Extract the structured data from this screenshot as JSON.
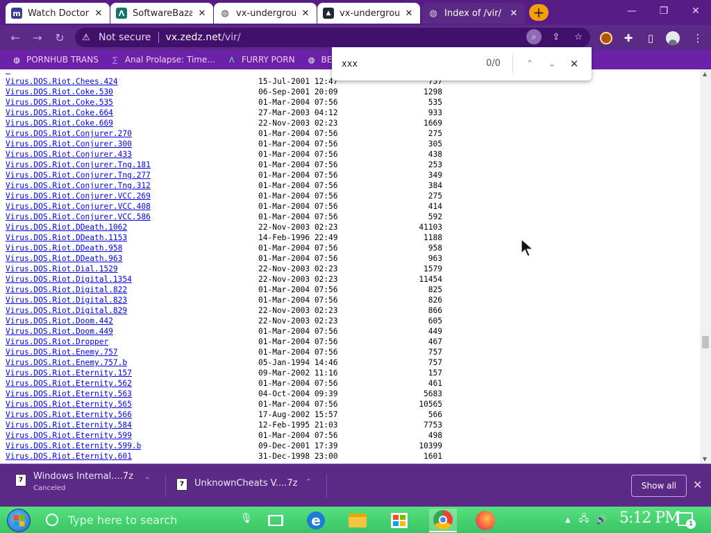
{
  "tabs": [
    {
      "label": "Watch Doctor",
      "icon": "m",
      "color": "#3b3b98",
      "state": "inactive"
    },
    {
      "label": "SoftwareBazaa",
      "icon": "Λ",
      "color": "#0f766e",
      "state": "inactive"
    },
    {
      "label": "vx-undergroun",
      "icon": "globe",
      "color": "#444444",
      "state": "inactive"
    },
    {
      "label": "vx-undergroun",
      "icon": "square",
      "color": "#1f2937",
      "state": "inactive"
    },
    {
      "label": "Index of /vir/",
      "icon": "globe",
      "color": "#6b7280",
      "state": "active"
    }
  ],
  "omnibox": {
    "security": "Not secure",
    "host": "vx.zedz.net",
    "path": "/vir/"
  },
  "bookmarks": [
    {
      "label": "PORNHUB TRANS",
      "icon": "globe"
    },
    {
      "label": "Anal Prolapse: Time...",
      "icon": "sigma"
    },
    {
      "label": "FURRY PORN",
      "icon": "Λ"
    },
    {
      "label": "BES",
      "icon": "globe"
    }
  ],
  "find": {
    "query": "xxx",
    "count": "0/0"
  },
  "files": [
    {
      "name": "Virus.DOS.Riot.Chees.424",
      "date": "15-Jul-2001 12:47",
      "size": "757"
    },
    {
      "name": "Virus.DOS.Riot.Coke.530",
      "date": "06-Sep-2001 20:09",
      "size": "1298"
    },
    {
      "name": "Virus.DOS.Riot.Coke.535",
      "date": "01-Mar-2004 07:56",
      "size": "535"
    },
    {
      "name": "Virus.DOS.Riot.Coke.664",
      "date": "27-Mar-2003 04:12",
      "size": "933"
    },
    {
      "name": "Virus.DOS.Riot.Coke.669",
      "date": "22-Nov-2003 02:23",
      "size": "1669"
    },
    {
      "name": "Virus.DOS.Riot.Conjurer.270",
      "date": "01-Mar-2004 07:56",
      "size": "275"
    },
    {
      "name": "Virus.DOS.Riot.Conjurer.300",
      "date": "01-Mar-2004 07:56",
      "size": "305"
    },
    {
      "name": "Virus.DOS.Riot.Conjurer.433",
      "date": "01-Mar-2004 07:56",
      "size": "438"
    },
    {
      "name": "Virus.DOS.Riot.Conjurer.Tng.181",
      "date": "01-Mar-2004 07:56",
      "size": "253"
    },
    {
      "name": "Virus.DOS.Riot.Conjurer.Tng.277",
      "date": "01-Mar-2004 07:56",
      "size": "349"
    },
    {
      "name": "Virus.DOS.Riot.Conjurer.Tng.312",
      "date": "01-Mar-2004 07:56",
      "size": "384"
    },
    {
      "name": "Virus.DOS.Riot.Conjurer.VCC.269",
      "date": "01-Mar-2004 07:56",
      "size": "275"
    },
    {
      "name": "Virus.DOS.Riot.Conjurer.VCC.408",
      "date": "01-Mar-2004 07:56",
      "size": "414"
    },
    {
      "name": "Virus.DOS.Riot.Conjurer.VCC.586",
      "date": "01-Mar-2004 07:56",
      "size": "592"
    },
    {
      "name": "Virus.DOS.Riot.DDeath.1062",
      "date": "22-Nov-2003 02:23",
      "size": "41103"
    },
    {
      "name": "Virus.DOS.Riot.DDeath.1153",
      "date": "14-Feb-1996 22:49",
      "size": "1188"
    },
    {
      "name": "Virus.DOS.Riot.DDeath.958",
      "date": "01-Mar-2004 07:56",
      "size": "958"
    },
    {
      "name": "Virus.DOS.Riot.DDeath.963",
      "date": "01-Mar-2004 07:56",
      "size": "963"
    },
    {
      "name": "Virus.DOS.Riot.Dial.1529",
      "date": "22-Nov-2003 02:23",
      "size": "1579"
    },
    {
      "name": "Virus.DOS.Riot.Digital.1354",
      "date": "22-Nov-2003 02:23",
      "size": "11454"
    },
    {
      "name": "Virus.DOS.Riot.Digital.822",
      "date": "01-Mar-2004 07:56",
      "size": "825"
    },
    {
      "name": "Virus.DOS.Riot.Digital.823",
      "date": "01-Mar-2004 07:56",
      "size": "826"
    },
    {
      "name": "Virus.DOS.Riot.Digital.829",
      "date": "22-Nov-2003 02:23",
      "size": "866"
    },
    {
      "name": "Virus.DOS.Riot.Doom.442",
      "date": "22-Nov-2003 02:23",
      "size": "605"
    },
    {
      "name": "Virus.DOS.Riot.Doom.449",
      "date": "01-Mar-2004 07:56",
      "size": "449"
    },
    {
      "name": "Virus.DOS.Riot.Dropper",
      "date": "01-Mar-2004 07:56",
      "size": "467"
    },
    {
      "name": "Virus.DOS.Riot.Enemy.757",
      "date": "01-Mar-2004 07:56",
      "size": "757"
    },
    {
      "name": "Virus.DOS.Riot.Enemy.757.b",
      "date": "05-Jan-1994 14:46",
      "size": "757"
    },
    {
      "name": "Virus.DOS.Riot.Eternity.157",
      "date": "09-Mar-2002 11:16",
      "size": "157"
    },
    {
      "name": "Virus.DOS.Riot.Eternity.562",
      "date": "01-Mar-2004 07:56",
      "size": "461"
    },
    {
      "name": "Virus.DOS.Riot.Eternity.563",
      "date": "04-Oct-2004 09:39",
      "size": "5683"
    },
    {
      "name": "Virus.DOS.Riot.Eternity.565",
      "date": "01-Mar-2004 07:56",
      "size": "10565"
    },
    {
      "name": "Virus.DOS.Riot.Eternity.566",
      "date": "17-Aug-2002 15:57",
      "size": "566"
    },
    {
      "name": "Virus.DOS.Riot.Eternity.584",
      "date": "12-Feb-1995 21:03",
      "size": "7753"
    },
    {
      "name": "Virus.DOS.Riot.Eternity.599",
      "date": "01-Mar-2004 07:56",
      "size": "498"
    },
    {
      "name": "Virus.DOS.Riot.Eternity.599.b",
      "date": "09-Dec-2001 17:39",
      "size": "10399"
    },
    {
      "name": "Virus.DOS.Riot.Eternity.601",
      "date": "31-Dec-1998 23:00",
      "size": "1601"
    }
  ],
  "downloads": [
    {
      "name": "Windows Internal....7z",
      "status": "Canceled"
    },
    {
      "name": "UnknownCheats V....7z",
      "status": ""
    }
  ],
  "downloads_show_all": "Show all",
  "taskbar": {
    "search_placeholder": "Type here to search",
    "clock": "5:12 PM",
    "notification_count": "1"
  },
  "colors": {
    "tabstrip": "#581c87",
    "toolbar": "#5b2a86",
    "bookmarks": "#6b21a8",
    "link": "#0000ee",
    "taskbar": "#39c565"
  }
}
